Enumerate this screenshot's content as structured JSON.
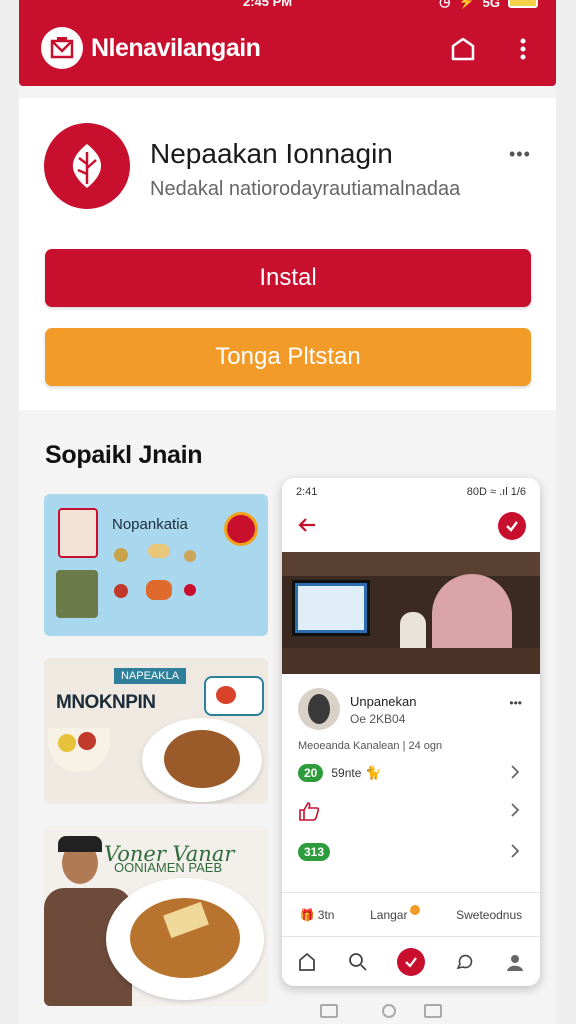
{
  "status_bar": {
    "time": "2:45 PM",
    "battery_label": "5G"
  },
  "header": {
    "title": "Nlenavilangain"
  },
  "app": {
    "name": "Nepaakan Ionnagin",
    "subtitle": "Nedakal natiorodayrautiamalnadaa",
    "install_label": "Instal",
    "secondary_label": "Tonga Pltstan"
  },
  "section": {
    "title": "Sopaikl Jnain"
  },
  "thumbs": [
    {
      "title": "Nopankatia"
    },
    {
      "title": "MNOKNPIN",
      "badge": "NAPEAKLA"
    },
    {
      "title": "Voner Vanar",
      "subtitle": "OONIAMEN PAEB"
    }
  ],
  "phone": {
    "status_time": "2:41",
    "status_icons": "80D ≈ .ıl 1/6",
    "post": {
      "name": "Unpanekan",
      "time": "Oe 2KB04",
      "description": "Meoeanda Kanalean | 24 ogn"
    },
    "rows": [
      {
        "pill": "20",
        "text": "59nte"
      },
      {
        "pill": "",
        "text": ""
      },
      {
        "pill": "313",
        "text": ""
      }
    ],
    "tabs": [
      "3tn",
      "Langar",
      "Sweteodnus"
    ]
  },
  "colors": {
    "brand": "#c8102e",
    "accent": "#f29b28",
    "green": "#2e9b3c"
  }
}
